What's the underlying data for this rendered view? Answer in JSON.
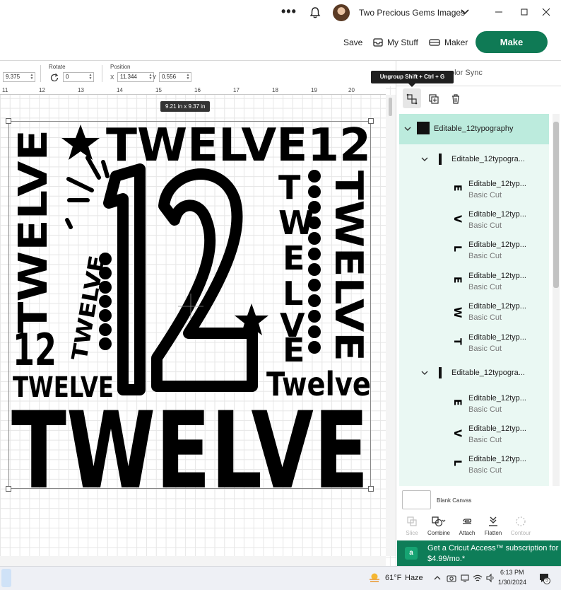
{
  "titlebar": {
    "dots": "•••",
    "username": "Two Precious Gems Images"
  },
  "header": {
    "save_label": "Save",
    "mystuff_label": "My Stuff",
    "maker_label": "Maker",
    "make_label": "Make",
    "make_color": "#0f7a55"
  },
  "toolbar": {
    "size_value": "9.375",
    "rotate_label": "Rotate",
    "rotate_value": "0",
    "position_label": "Position",
    "x_label": "X",
    "x_value": "11.344",
    "y_label": "Y",
    "y_value": "0.556"
  },
  "canvas": {
    "ruler_ticks": [
      "11",
      "12",
      "13",
      "14",
      "15",
      "16",
      "17",
      "18",
      "19",
      "20"
    ],
    "size_tag": "9.21  in x 9.37  in"
  },
  "panel": {
    "tooltip": "Ungroup Shift + Ctrl + G",
    "color_sync_label": "olor Sync",
    "top_layer": "Editable_12typography",
    "groups": [
      {
        "name": "Editable_12typogra...",
        "items": [
          {
            "name": "Editable_12typ...",
            "sub": "Basic Cut",
            "glyph": "E"
          },
          {
            "name": "Editable_12typ...",
            "sub": "Basic Cut",
            "glyph": "V"
          },
          {
            "name": "Editable_12typ...",
            "sub": "Basic Cut",
            "glyph": "L"
          },
          {
            "name": "Editable_12typ...",
            "sub": "Basic Cut",
            "glyph": "E"
          },
          {
            "name": "Editable_12typ...",
            "sub": "Basic Cut",
            "glyph": "W"
          },
          {
            "name": "Editable_12typ...",
            "sub": "Basic Cut",
            "glyph": "T"
          }
        ]
      },
      {
        "name": "Editable_12typogra...",
        "items": [
          {
            "name": "Editable_12typ...",
            "sub": "Basic Cut",
            "glyph": "E"
          },
          {
            "name": "Editable_12typ...",
            "sub": "Basic Cut",
            "glyph": "V"
          },
          {
            "name": "Editable_12typ...",
            "sub": "Basic Cut",
            "glyph": "L"
          }
        ]
      }
    ],
    "blank_canvas_label": "Blank Canvas",
    "bottom_tools": {
      "slice": "Slice",
      "combine": "Combine",
      "attach": "Attach",
      "flatten": "Flatten",
      "contour": "Contour"
    },
    "promo_badge": "a",
    "promo_text": "Get a Cricut Access™ subscription for $4.99/mo.*",
    "layer_bg": "#eaf8f3",
    "layer_selected_bg": "#bcebdd"
  },
  "taskbar": {
    "temp": "61°F",
    "condition": "Haze",
    "time": "6:13 PM",
    "date": "1/30/2024",
    "notif_count": "5"
  }
}
